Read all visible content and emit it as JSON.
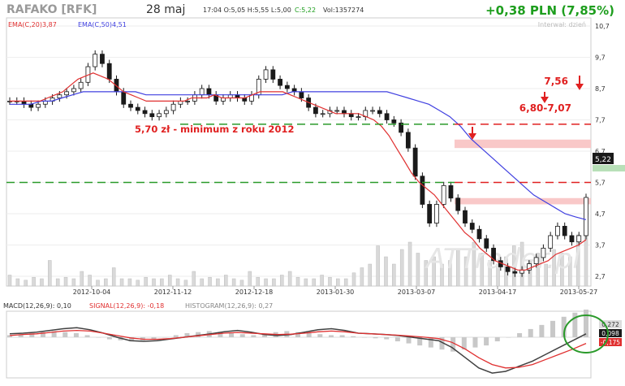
{
  "header": {
    "ticker": "RAFAKO [RFK]",
    "date": "28 maj",
    "quote": "17:04 O:5,05 H:5,55 L:5,00",
    "close_label": "C:5,22",
    "volume": "Vol:1357274",
    "change": "+0,38 PLN (7,85%)",
    "interval": "Interwał: dzień"
  },
  "legend": {
    "ema20": "EMA(C,20)3,87",
    "ema50": "EMA(C,50)4,51"
  },
  "annotations": {
    "min2012": "5,70 zł -  minimum z roku 2012",
    "level756": "7,56",
    "zone680": "6,80-7,07"
  },
  "price_tag": "5,22",
  "watermark": "ATTrader.pl",
  "macd": {
    "macd_label": "MACD(12,26,9): 0,10",
    "signal_label": "SIGNAL(12,26,9): -0,18",
    "hist_label": "HISTOGRAM(12,26,9): 0,27",
    "tag_hist": "0,272",
    "tag_macd": "0,098",
    "tag_signal": "-0,175"
  },
  "colors": {
    "up": "#1a1a1a",
    "ema20": "#e03030",
    "ema50": "#4040e0",
    "annotation": "#e02020",
    "support": "#2a9a2a",
    "change": "#1e9e1e"
  },
  "chart_data": {
    "type": "candlestick",
    "y_ticks": [
      10.7,
      9.7,
      8.7,
      7.7,
      6.7,
      5.7,
      4.7,
      3.7,
      2.7
    ],
    "y_tick_labels": [
      "10,7",
      "9,7",
      "8,7",
      "7,7",
      "6,7",
      "5,7",
      "4,7",
      "3,7",
      "2,7"
    ],
    "x_tick_labels": [
      "2012-10-04",
      "2012-11-12",
      "2012-12-18",
      "2013-01-30",
      "2013-03-07",
      "2013-04-17",
      "2013-05-27"
    ],
    "levels": {
      "support_green": [
        7.56,
        5.7
      ],
      "resistance_red": [
        7.56,
        5.7
      ]
    },
    "zones": [
      [
        6.8,
        7.07
      ],
      [
        5.0,
        5.2
      ]
    ],
    "close_path": [
      8.3,
      8.3,
      8.2,
      8.1,
      8.2,
      8.3,
      8.4,
      8.5,
      8.6,
      8.7,
      8.9,
      9.4,
      9.8,
      9.5,
      9.0,
      8.6,
      8.2,
      8.1,
      8.0,
      7.9,
      7.8,
      7.9,
      8.0,
      8.2,
      8.3,
      8.3,
      8.5,
      8.7,
      8.5,
      8.3,
      8.4,
      8.5,
      8.4,
      8.3,
      8.5,
      9.0,
      9.3,
      9.0,
      8.8,
      8.7,
      8.6,
      8.4,
      8.1,
      7.9,
      7.9,
      8.0,
      8.0,
      7.9,
      7.8,
      7.8,
      8.0,
      8.0,
      7.9,
      7.7,
      7.6,
      7.3,
      6.8,
      5.9,
      5.0,
      4.4,
      5.0,
      5.6,
      5.2,
      4.8,
      4.4,
      4.2,
      3.9,
      3.6,
      3.2,
      3.0,
      2.85,
      2.8,
      2.9,
      3.1,
      3.3,
      3.6,
      4.0,
      4.3,
      4.0,
      3.8,
      4.0,
      5.22
    ],
    "ema20": [
      8.3,
      8.3,
      8.3,
      8.3,
      8.3,
      8.4,
      8.5,
      8.6,
      8.8,
      9.0,
      9.1,
      9.2,
      9.1,
      9.0,
      8.8,
      8.6,
      8.5,
      8.4,
      8.3,
      8.3,
      8.3,
      8.3,
      8.3,
      8.3,
      8.4,
      8.4,
      8.4,
      8.5,
      8.4,
      8.4,
      8.4,
      8.4,
      8.5,
      8.6,
      8.6,
      8.6,
      8.6,
      8.5,
      8.4,
      8.3,
      8.2,
      8.1,
      8.0,
      7.9,
      7.9,
      7.9,
      7.9,
      7.8,
      7.7,
      7.5,
      7.2,
      6.8,
      6.4,
      6.0,
      5.7,
      5.5,
      5.3,
      5.0,
      4.7,
      4.4,
      4.1,
      3.9,
      3.6,
      3.4,
      3.2,
      3.1,
      3.0,
      2.9,
      2.9,
      3.0,
      3.1,
      3.2,
      3.4,
      3.5,
      3.6,
      3.7,
      3.87
    ],
    "ema50": [
      8.2,
      8.2,
      8.2,
      8.3,
      8.3,
      8.4,
      8.5,
      8.6,
      8.6,
      8.6,
      8.6,
      8.6,
      8.6,
      8.5,
      8.5,
      8.5,
      8.5,
      8.5,
      8.5,
      8.5,
      8.5,
      8.5,
      8.5,
      8.5,
      8.5,
      8.5,
      8.5,
      8.6,
      8.6,
      8.6,
      8.6,
      8.6,
      8.6,
      8.6,
      8.6,
      8.6,
      8.6,
      8.5,
      8.4,
      8.3,
      8.2,
      8.0,
      7.8,
      7.5,
      7.1,
      6.8,
      6.5,
      6.2,
      5.9,
      5.6,
      5.3,
      5.1,
      4.9,
      4.7,
      4.6,
      4.51
    ],
    "volume_relative": [
      0.15,
      0.1,
      0.08,
      0.12,
      0.1,
      0.35,
      0.1,
      0.12,
      0.1,
      0.2,
      0.15,
      0.08,
      0.1,
      0.25,
      0.1,
      0.1,
      0.08,
      0.12,
      0.1,
      0.1,
      0.15,
      0.1,
      0.08,
      0.2,
      0.1,
      0.12,
      0.1,
      0.15,
      0.1,
      0.08,
      0.2,
      0.12,
      0.1,
      0.1,
      0.15,
      0.2,
      0.12,
      0.1,
      0.1,
      0.15,
      0.12,
      0.1,
      0.1,
      0.18,
      0.25,
      0.3,
      0.55,
      0.4,
      0.3,
      0.5,
      0.6,
      0.45,
      0.35,
      0.4,
      0.3,
      0.35,
      0.5,
      0.4,
      0.6,
      0.45,
      0.35,
      0.3,
      0.4,
      0.55,
      0.6,
      0.35,
      0.45,
      0.3,
      0.5,
      0.45,
      0.4,
      0.7,
      0.9
    ],
    "macd_hist": [
      0.02,
      0.03,
      0.04,
      0.05,
      0.06,
      0.05,
      0.04,
      0.02,
      0.0,
      -0.02,
      -0.03,
      -0.04,
      -0.03,
      -0.02,
      0.0,
      0.02,
      0.04,
      0.05,
      0.06,
      0.05,
      0.04,
      0.03,
      0.02,
      0.03,
      0.05,
      0.06,
      0.05,
      0.04,
      0.03,
      0.02,
      0.02,
      0.01,
      0.0,
      -0.01,
      -0.02,
      -0.04,
      -0.06,
      -0.08,
      -0.1,
      -0.12,
      -0.14,
      -0.12,
      -0.1,
      -0.08,
      -0.04,
      0.0,
      0.04,
      0.08,
      0.12,
      0.16,
      0.2,
      0.24,
      0.27
    ],
    "macd_line": [
      0.1,
      0.12,
      0.15,
      0.2,
      0.25,
      0.28,
      0.22,
      0.12,
      0.0,
      -0.1,
      -0.12,
      -0.1,
      -0.05,
      0.0,
      0.05,
      0.1,
      0.16,
      0.2,
      0.15,
      0.08,
      0.05,
      0.08,
      0.15,
      0.22,
      0.25,
      0.2,
      0.12,
      0.1,
      0.08,
      0.05,
      0.0,
      -0.05,
      -0.1,
      -0.3,
      -0.6,
      -0.9,
      -1.05,
      -1.0,
      -0.85,
      -0.7,
      -0.5,
      -0.3,
      -0.1,
      0.1
    ],
    "signal_line": [
      0.05,
      0.08,
      0.1,
      0.14,
      0.18,
      0.2,
      0.18,
      0.12,
      0.05,
      -0.02,
      -0.06,
      -0.06,
      -0.04,
      0.0,
      0.04,
      0.08,
      0.12,
      0.14,
      0.12,
      0.1,
      0.08,
      0.09,
      0.12,
      0.16,
      0.18,
      0.16,
      0.12,
      0.1,
      0.08,
      0.06,
      0.03,
      0.0,
      -0.04,
      -0.15,
      -0.35,
      -0.6,
      -0.8,
      -0.9,
      -0.88,
      -0.8,
      -0.65,
      -0.5,
      -0.35,
      -0.18
    ]
  }
}
